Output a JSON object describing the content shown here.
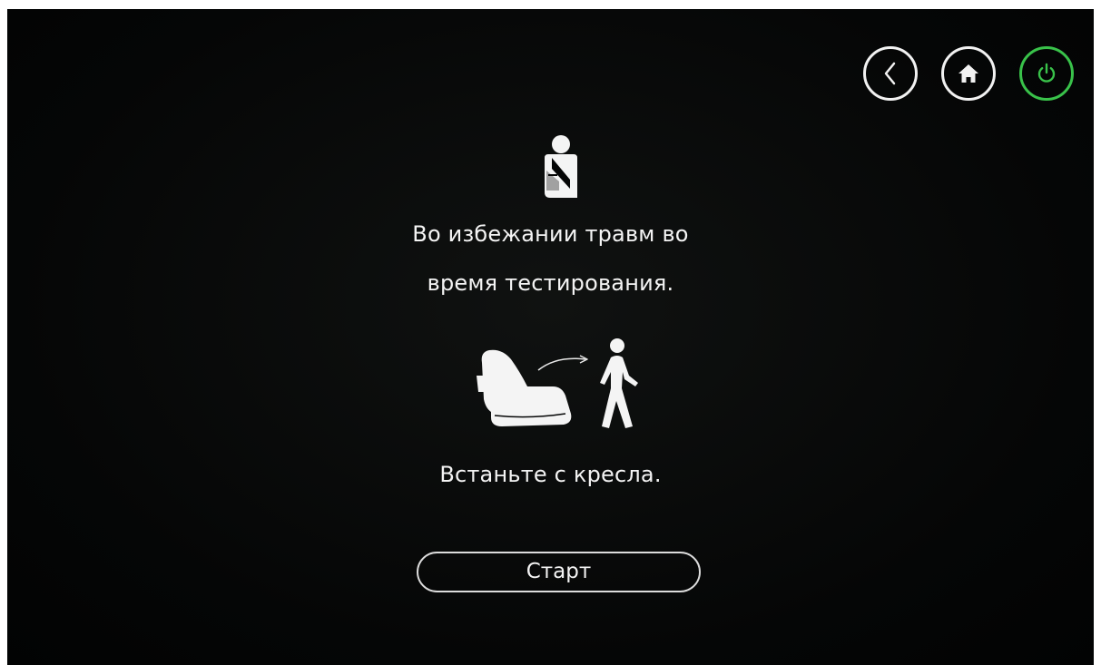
{
  "header": {
    "buttons": [
      {
        "icon": "back-icon"
      },
      {
        "icon": "home-icon"
      },
      {
        "icon": "power-icon",
        "accent": "#39c24a"
      }
    ]
  },
  "main": {
    "warning_icon": "injured-person-icon",
    "line1": "Во избежании травм во",
    "line2": "время тестирования.",
    "instruction_icon": "leave-chair-icon",
    "line3": "Встаньте с кресла.",
    "start_label": "Старт"
  },
  "colors": {
    "background": "#050606",
    "text": "#f4f4f4",
    "power_accent": "#39c24a"
  }
}
